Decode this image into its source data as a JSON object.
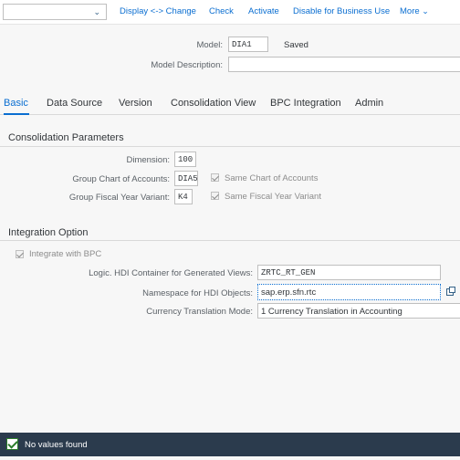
{
  "toolbar": {
    "select_value": "",
    "actions": [
      "Display <-> Change",
      "Check",
      "Activate",
      "Disable for Business Use",
      "More"
    ]
  },
  "header": {
    "model_label": "Model:",
    "model_value": "DIA1",
    "model_status": "Saved",
    "description_label": "Model Description:",
    "description_value": ""
  },
  "tabs": [
    "Basic",
    "Data Source",
    "Version",
    "Consolidation View",
    "BPC Integration",
    "Admin"
  ],
  "active_tab": "Basic",
  "consolidation": {
    "title": "Consolidation Parameters",
    "dimension_label": "Dimension:",
    "dimension_value": "100",
    "chart_label": "Group Chart of Accounts:",
    "chart_value": "DIA5",
    "same_chart_label": "Same Chart of Accounts",
    "same_chart_checked": true,
    "fiscal_label": "Group Fiscal Year Variant:",
    "fiscal_value": "K4",
    "same_fiscal_label": "Same Fiscal Year Variant",
    "same_fiscal_checked": true
  },
  "integration": {
    "title": "Integration Option",
    "integrate_label": "Integrate with BPC",
    "integrate_checked": true,
    "hdi_container_label": "Logic. HDI Container for Generated Views:",
    "hdi_container_value": "ZRTC_RT_GEN",
    "namespace_label": "Namespace for HDI Objects:",
    "namespace_value": "sap.erp.sfn.rtc",
    "currency_mode_label": "Currency Translation Mode:",
    "currency_mode_value": "1 Currency Translation in Accounting"
  },
  "status": {
    "message": "No values found",
    "type": "success"
  },
  "colors": {
    "accent": "#0a6ed1",
    "status_bar": "#2b3b4d",
    "success": "#2b7d2b"
  }
}
